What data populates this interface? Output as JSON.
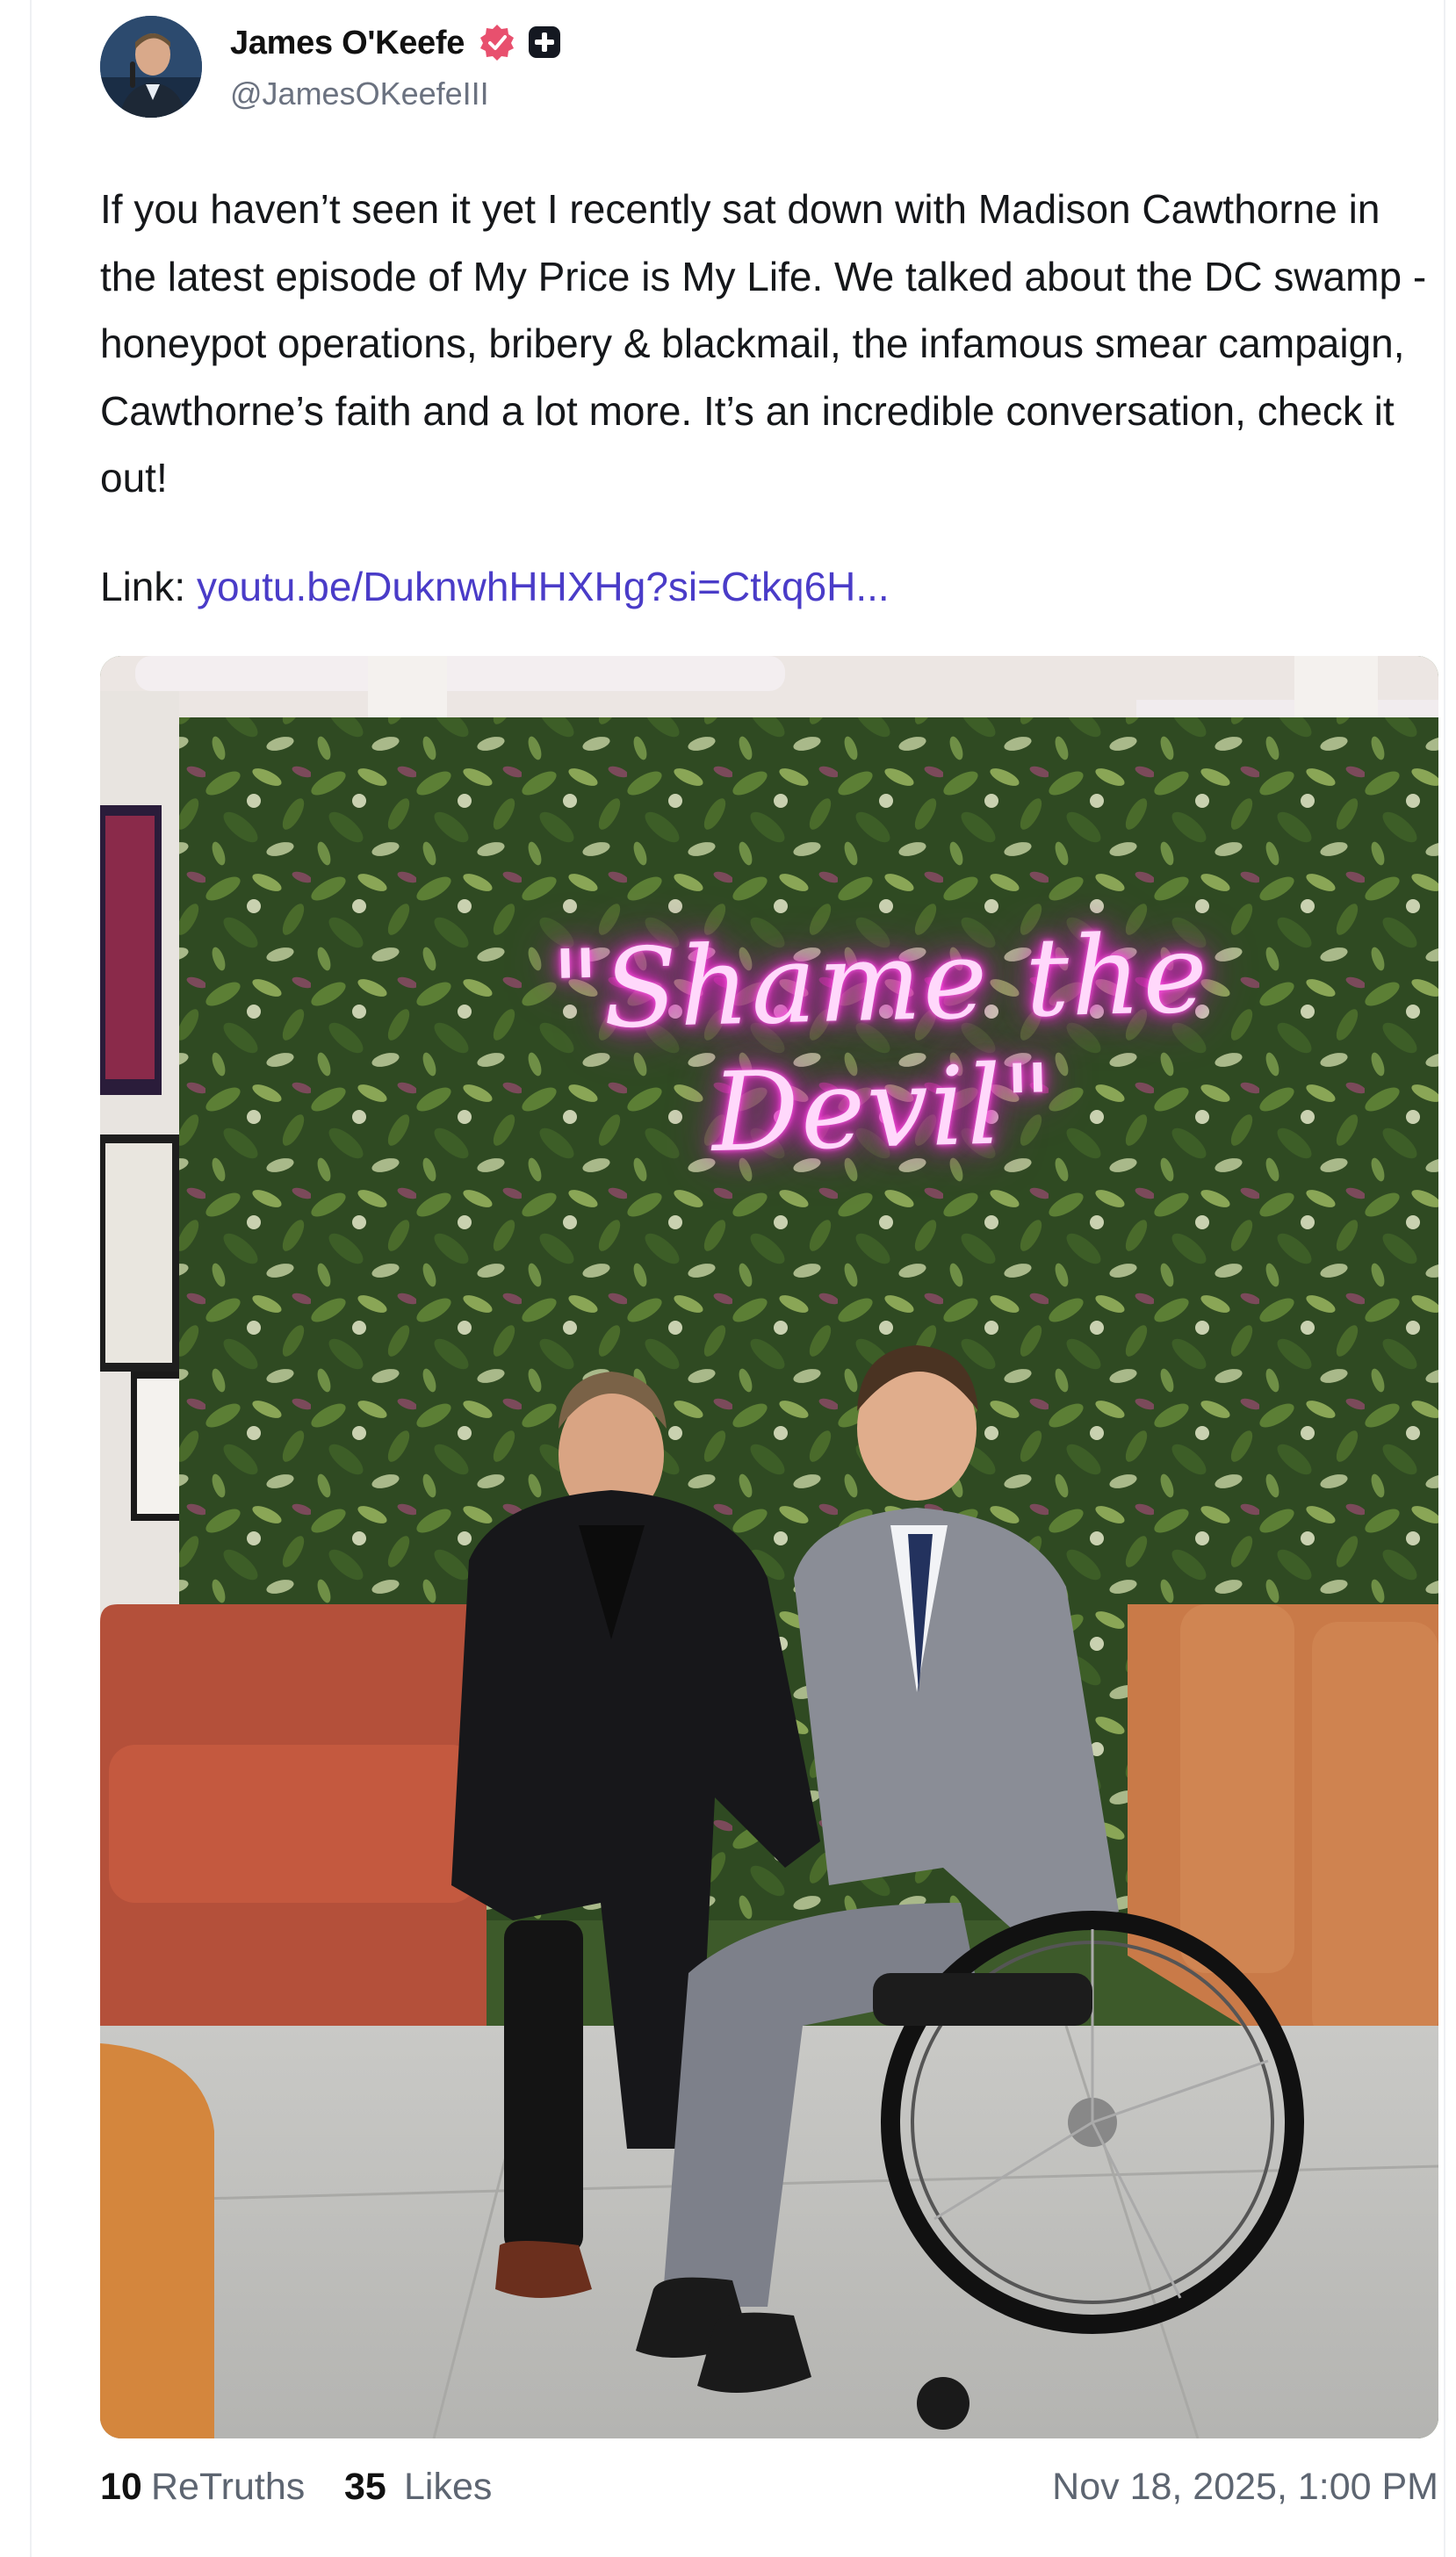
{
  "author": {
    "name": "James O'Keefe",
    "handle": "@JamesOKeefeIII"
  },
  "post": {
    "text": "If you haven’t seen it yet I recently sat down with Madison Cawthorne in the latest episode of My Price is My Life. We talked about the DC swamp - honeypot operations, bribery & blackmail, the infamous smear campaign, Cawthorne’s faith and a lot more. It’s an incredible conversation, check it out!",
    "link_label": "Link: ",
    "link_text": "youtu.be/DuknwhHHXHg?si=Ctkq6H...",
    "image_neon_sign": "\"Shame the Devil\""
  },
  "stats": {
    "retruths_count": "10",
    "retruths_label": "ReTruths",
    "likes_count": "35",
    "likes_label": "Likes",
    "timestamp": "Nov 18, 2025, 1:00 PM"
  },
  "colors": {
    "link": "#4a3cc8",
    "verified_badge": "#e8506e",
    "neon": "#ff4fe0"
  },
  "icons": {
    "verified": "verified-icon",
    "plus_badge": "plus-badge-icon"
  }
}
